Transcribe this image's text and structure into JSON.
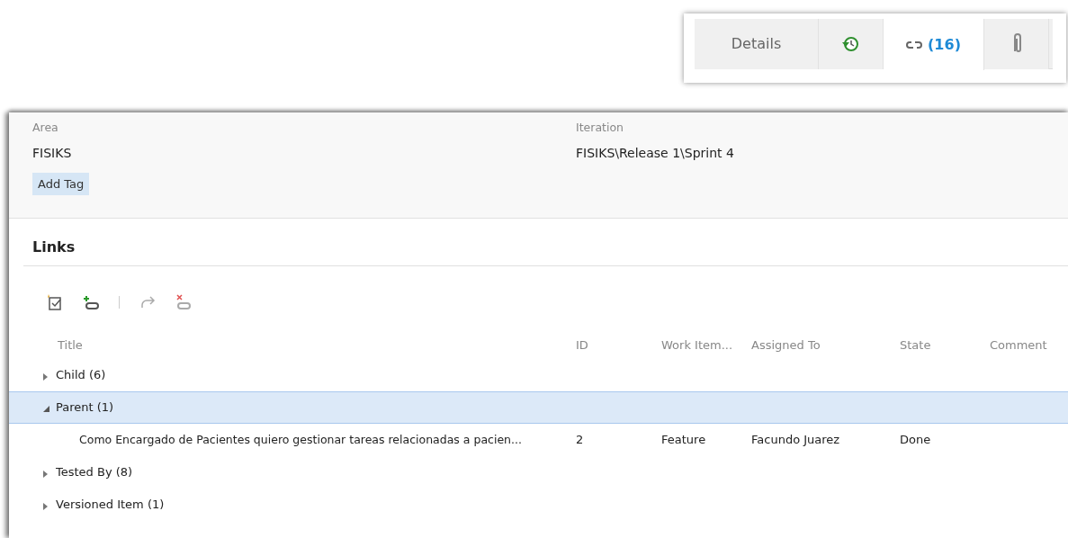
{
  "tabs": [
    {
      "kind": "text",
      "label": "Details",
      "selected": false
    },
    {
      "kind": "history",
      "selected": false
    },
    {
      "kind": "links",
      "count": "(16)",
      "selected": true
    },
    {
      "kind": "attachment",
      "selected": false
    }
  ],
  "fields": [
    {
      "label": "Area",
      "value": "FISIKS"
    },
    {
      "label": "Iteration",
      "value": "FISIKS\\Release 1\\Sprint 4"
    }
  ],
  "add_tag": "Add Tag",
  "links": {
    "title": "Links",
    "toolbar": [
      {
        "kind": "newitem",
        "disabled": false
      },
      {
        "kind": "addlink",
        "disabled": false
      },
      {
        "kind": "separator"
      },
      {
        "kind": "redo",
        "disabled": true
      },
      {
        "kind": "unlink",
        "disabled": true
      }
    ],
    "columns": [
      "Title",
      "ID",
      "Work Item...",
      "Assigned To",
      "State",
      "Comment"
    ],
    "rows": [
      {
        "title": "Child (6)",
        "expanded": false,
        "selected": false
      },
      {
        "title": "Parent (1)",
        "expanded": true,
        "selected": true,
        "children": [
          {
            "title": "Como Encargado de Pacientes quiero gestionar tareas relacionadas a pacien...",
            "id": "2",
            "type": "Feature",
            "assigned_to": "Facundo Juarez",
            "state": "Done"
          }
        ]
      },
      {
        "title": "Tested By (8)",
        "expanded": false,
        "selected": false
      },
      {
        "title": "Versioned Item (1)",
        "expanded": false,
        "selected": false
      }
    ]
  }
}
